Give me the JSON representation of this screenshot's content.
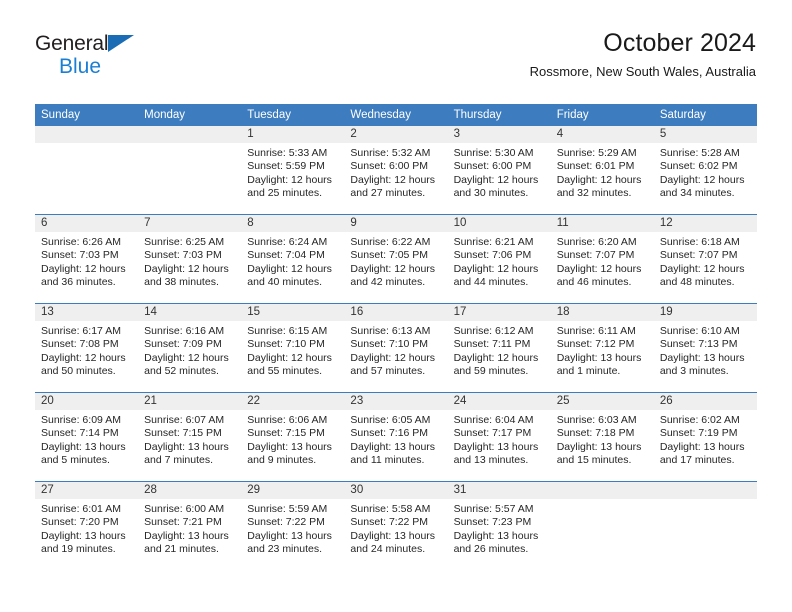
{
  "brand": {
    "name_top": "General",
    "name_bottom": "Blue",
    "triangle_icon": "blue-triangle-icon",
    "color_dark": "#231f20",
    "color_blue": "#1a7fd4"
  },
  "header": {
    "title": "October 2024",
    "subtitle": "Rossmore, New South Wales, Australia"
  },
  "theme": {
    "header_blue": "#3c7cbf",
    "band_gray": "#efefef",
    "text": "#262626"
  },
  "weekdays": [
    "Sunday",
    "Monday",
    "Tuesday",
    "Wednesday",
    "Thursday",
    "Friday",
    "Saturday"
  ],
  "weeks": [
    [
      {
        "day": "",
        "lines": []
      },
      {
        "day": "",
        "lines": []
      },
      {
        "day": "1",
        "lines": [
          "Sunrise: 5:33 AM",
          "Sunset: 5:59 PM",
          "Daylight: 12 hours and 25 minutes."
        ]
      },
      {
        "day": "2",
        "lines": [
          "Sunrise: 5:32 AM",
          "Sunset: 6:00 PM",
          "Daylight: 12 hours and 27 minutes."
        ]
      },
      {
        "day": "3",
        "lines": [
          "Sunrise: 5:30 AM",
          "Sunset: 6:00 PM",
          "Daylight: 12 hours and 30 minutes."
        ]
      },
      {
        "day": "4",
        "lines": [
          "Sunrise: 5:29 AM",
          "Sunset: 6:01 PM",
          "Daylight: 12 hours and 32 minutes."
        ]
      },
      {
        "day": "5",
        "lines": [
          "Sunrise: 5:28 AM",
          "Sunset: 6:02 PM",
          "Daylight: 12 hours and 34 minutes."
        ]
      }
    ],
    [
      {
        "day": "6",
        "lines": [
          "Sunrise: 6:26 AM",
          "Sunset: 7:03 PM",
          "Daylight: 12 hours and 36 minutes."
        ]
      },
      {
        "day": "7",
        "lines": [
          "Sunrise: 6:25 AM",
          "Sunset: 7:03 PM",
          "Daylight: 12 hours and 38 minutes."
        ]
      },
      {
        "day": "8",
        "lines": [
          "Sunrise: 6:24 AM",
          "Sunset: 7:04 PM",
          "Daylight: 12 hours and 40 minutes."
        ]
      },
      {
        "day": "9",
        "lines": [
          "Sunrise: 6:22 AM",
          "Sunset: 7:05 PM",
          "Daylight: 12 hours and 42 minutes."
        ]
      },
      {
        "day": "10",
        "lines": [
          "Sunrise: 6:21 AM",
          "Sunset: 7:06 PM",
          "Daylight: 12 hours and 44 minutes."
        ]
      },
      {
        "day": "11",
        "lines": [
          "Sunrise: 6:20 AM",
          "Sunset: 7:07 PM",
          "Daylight: 12 hours and 46 minutes."
        ]
      },
      {
        "day": "12",
        "lines": [
          "Sunrise: 6:18 AM",
          "Sunset: 7:07 PM",
          "Daylight: 12 hours and 48 minutes."
        ]
      }
    ],
    [
      {
        "day": "13",
        "lines": [
          "Sunrise: 6:17 AM",
          "Sunset: 7:08 PM",
          "Daylight: 12 hours and 50 minutes."
        ]
      },
      {
        "day": "14",
        "lines": [
          "Sunrise: 6:16 AM",
          "Sunset: 7:09 PM",
          "Daylight: 12 hours and 52 minutes."
        ]
      },
      {
        "day": "15",
        "lines": [
          "Sunrise: 6:15 AM",
          "Sunset: 7:10 PM",
          "Daylight: 12 hours and 55 minutes."
        ]
      },
      {
        "day": "16",
        "lines": [
          "Sunrise: 6:13 AM",
          "Sunset: 7:10 PM",
          "Daylight: 12 hours and 57 minutes."
        ]
      },
      {
        "day": "17",
        "lines": [
          "Sunrise: 6:12 AM",
          "Sunset: 7:11 PM",
          "Daylight: 12 hours and 59 minutes."
        ]
      },
      {
        "day": "18",
        "lines": [
          "Sunrise: 6:11 AM",
          "Sunset: 7:12 PM",
          "Daylight: 13 hours and 1 minute."
        ]
      },
      {
        "day": "19",
        "lines": [
          "Sunrise: 6:10 AM",
          "Sunset: 7:13 PM",
          "Daylight: 13 hours and 3 minutes."
        ]
      }
    ],
    [
      {
        "day": "20",
        "lines": [
          "Sunrise: 6:09 AM",
          "Sunset: 7:14 PM",
          "Daylight: 13 hours and 5 minutes."
        ]
      },
      {
        "day": "21",
        "lines": [
          "Sunrise: 6:07 AM",
          "Sunset: 7:15 PM",
          "Daylight: 13 hours and 7 minutes."
        ]
      },
      {
        "day": "22",
        "lines": [
          "Sunrise: 6:06 AM",
          "Sunset: 7:15 PM",
          "Daylight: 13 hours and 9 minutes."
        ]
      },
      {
        "day": "23",
        "lines": [
          "Sunrise: 6:05 AM",
          "Sunset: 7:16 PM",
          "Daylight: 13 hours and 11 minutes."
        ]
      },
      {
        "day": "24",
        "lines": [
          "Sunrise: 6:04 AM",
          "Sunset: 7:17 PM",
          "Daylight: 13 hours and 13 minutes."
        ]
      },
      {
        "day": "25",
        "lines": [
          "Sunrise: 6:03 AM",
          "Sunset: 7:18 PM",
          "Daylight: 13 hours and 15 minutes."
        ]
      },
      {
        "day": "26",
        "lines": [
          "Sunrise: 6:02 AM",
          "Sunset: 7:19 PM",
          "Daylight: 13 hours and 17 minutes."
        ]
      }
    ],
    [
      {
        "day": "27",
        "lines": [
          "Sunrise: 6:01 AM",
          "Sunset: 7:20 PM",
          "Daylight: 13 hours and 19 minutes."
        ]
      },
      {
        "day": "28",
        "lines": [
          "Sunrise: 6:00 AM",
          "Sunset: 7:21 PM",
          "Daylight: 13 hours and 21 minutes."
        ]
      },
      {
        "day": "29",
        "lines": [
          "Sunrise: 5:59 AM",
          "Sunset: 7:22 PM",
          "Daylight: 13 hours and 23 minutes."
        ]
      },
      {
        "day": "30",
        "lines": [
          "Sunrise: 5:58 AM",
          "Sunset: 7:22 PM",
          "Daylight: 13 hours and 24 minutes."
        ]
      },
      {
        "day": "31",
        "lines": [
          "Sunrise: 5:57 AM",
          "Sunset: 7:23 PM",
          "Daylight: 13 hours and 26 minutes."
        ]
      },
      {
        "day": "",
        "lines": []
      },
      {
        "day": "",
        "lines": []
      }
    ]
  ]
}
